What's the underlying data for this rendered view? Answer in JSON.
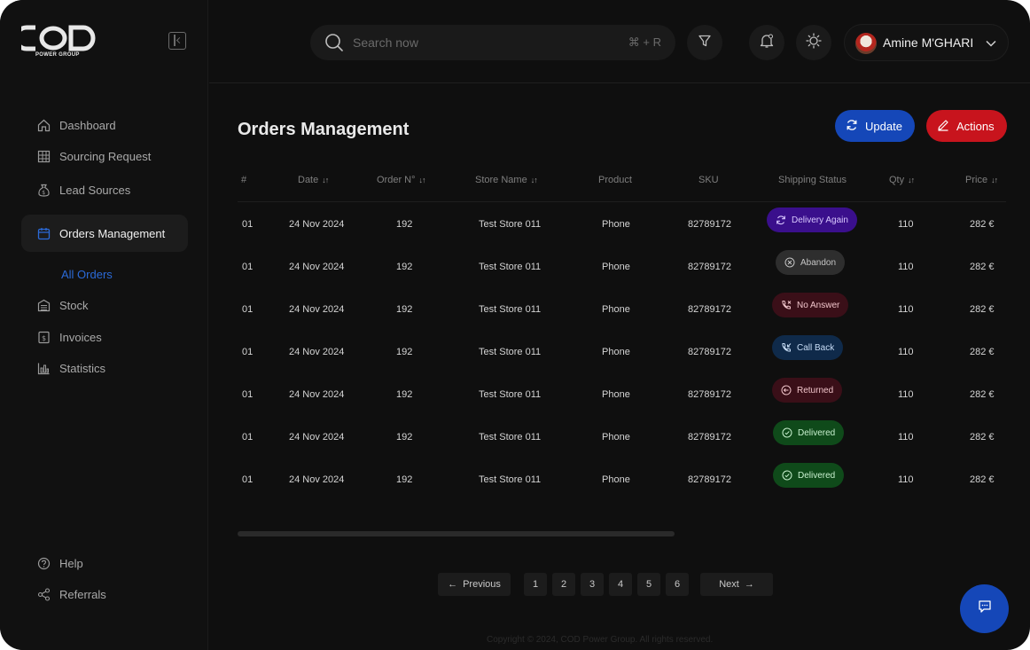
{
  "brand": {
    "logo_text": "COD",
    "logo_subtitle": "POWER GROUP"
  },
  "sidebar": {
    "items": [
      {
        "label": "Dashboard",
        "icon": "home-icon"
      },
      {
        "label": "Sourcing Request",
        "icon": "grid-icon"
      },
      {
        "label": "Lead Sources",
        "icon": "money-bag-icon"
      },
      {
        "label": "Orders Management",
        "icon": "calendar-icon",
        "active": true
      },
      {
        "label": "Stock",
        "icon": "warehouse-icon"
      },
      {
        "label": "Invoices",
        "icon": "invoice-icon"
      },
      {
        "label": "Statistics",
        "icon": "bar-chart-icon"
      }
    ],
    "sub_item": "All Orders",
    "bottom_items": [
      {
        "label": "Help",
        "icon": "help-icon"
      },
      {
        "label": "Referrals",
        "icon": "share-icon"
      }
    ]
  },
  "header": {
    "search_placeholder": "Search now",
    "search_shortcut": "⌘ + R",
    "user_name": "Amine M'GHARI"
  },
  "main": {
    "title": "Orders Management",
    "update_label": "Update",
    "actions_label": "Actions",
    "columns": [
      "#",
      "Date",
      "Order N°",
      "Store Name",
      "Product",
      "SKU",
      "Shipping Status",
      "Qty",
      "Price"
    ],
    "rows": [
      {
        "num": "01",
        "date": "24 Nov 2024",
        "order": "192",
        "store": "Test Store 011",
        "product": "Phone",
        "sku": "82789172",
        "status": "Delivery Again",
        "qty": "110",
        "price": "282 €"
      },
      {
        "num": "01",
        "date": "24 Nov 2024",
        "order": "192",
        "store": "Test Store 011",
        "product": "Phone",
        "sku": "82789172",
        "status": "Abandon",
        "qty": "110",
        "price": "282 €"
      },
      {
        "num": "01",
        "date": "24 Nov 2024",
        "order": "192",
        "store": "Test Store 011",
        "product": "Phone",
        "sku": "82789172",
        "status": "No Answer",
        "qty": "110",
        "price": "282 €"
      },
      {
        "num": "01",
        "date": "24 Nov 2024",
        "order": "192",
        "store": "Test Store 011",
        "product": "Phone",
        "sku": "82789172",
        "status": "Call Back",
        "qty": "110",
        "price": "282 €"
      },
      {
        "num": "01",
        "date": "24 Nov 2024",
        "order": "192",
        "store": "Test Store 011",
        "product": "Phone",
        "sku": "82789172",
        "status": "Returned",
        "qty": "110",
        "price": "282 €"
      },
      {
        "num": "01",
        "date": "24 Nov 2024",
        "order": "192",
        "store": "Test Store 011",
        "product": "Phone",
        "sku": "82789172",
        "status": "Delivered",
        "qty": "110",
        "price": "282 €"
      },
      {
        "num": "01",
        "date": "24 Nov 2024",
        "order": "192",
        "store": "Test Store 011",
        "product": "Phone",
        "sku": "82789172",
        "status": "Delivered",
        "qty": "110",
        "price": "282 €"
      }
    ],
    "status_styles": {
      "Delivery Again": {
        "bg": "#3a0f8c",
        "fg": "#d9c8ff",
        "icon": "refresh-icon"
      },
      "Abandon": {
        "bg": "#2e2e2e",
        "fg": "#c4c4c4",
        "icon": "x-circle-icon"
      },
      "No Answer": {
        "bg": "#3a0f18",
        "fg": "#f0c4ca",
        "icon": "phone-missed-icon"
      },
      "Call Back": {
        "bg": "#0f2a4a",
        "fg": "#c8ddf6",
        "icon": "phone-callback-icon"
      },
      "Returned": {
        "bg": "#3a0f18",
        "fg": "#f0c4ca",
        "icon": "return-icon"
      },
      "Delivered": {
        "bg": "#0f4a1a",
        "fg": "#c8f0cf",
        "icon": "check-circle-icon"
      }
    }
  },
  "pagination": {
    "previous": "Previous",
    "next": "Next",
    "pages": [
      "1",
      "2",
      "3",
      "4",
      "5",
      "6"
    ]
  },
  "footer": {
    "copyright": "Copyright © 2024, COD Power Group. All rights reserved."
  },
  "colors": {
    "accent_blue": "#1547b8",
    "accent_red": "#c8141d",
    "sub_item_blue": "#2b6ad8"
  }
}
